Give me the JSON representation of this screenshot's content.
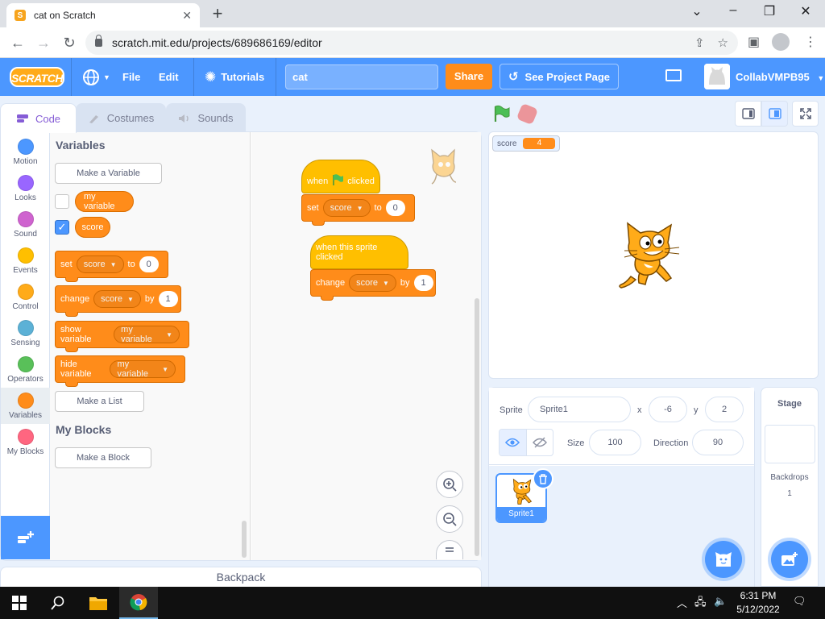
{
  "browser": {
    "tab_title": "cat on Scratch",
    "url": "scratch.mit.edu/projects/689686169/editor"
  },
  "menubar": {
    "logo_text": "SCRATCH",
    "file": "File",
    "edit": "Edit",
    "tutorials": "Tutorials",
    "project_title": "cat",
    "share": "Share",
    "see_project_page": "See Project Page",
    "username": "CollabVMPB95"
  },
  "editor_tabs": {
    "code": "Code",
    "costumes": "Costumes",
    "sounds": "Sounds"
  },
  "categories": [
    {
      "label": "Motion",
      "color": "#4c97ff"
    },
    {
      "label": "Looks",
      "color": "#9966ff"
    },
    {
      "label": "Sound",
      "color": "#cf63cf"
    },
    {
      "label": "Events",
      "color": "#ffbf00"
    },
    {
      "label": "Control",
      "color": "#ffab19"
    },
    {
      "label": "Sensing",
      "color": "#5cb1d6"
    },
    {
      "label": "Operators",
      "color": "#59c059"
    },
    {
      "label": "Variables",
      "color": "#ff8c1a"
    },
    {
      "label": "My Blocks",
      "color": "#ff6680"
    }
  ],
  "palette": {
    "variables_heading": "Variables",
    "make_variable": "Make a Variable",
    "var_my_variable": "my variable",
    "var_score": "score",
    "block_set": {
      "verb": "set",
      "var": "score",
      "to": "to",
      "value": "0"
    },
    "block_change": {
      "verb": "change",
      "var": "score",
      "by": "by",
      "value": "1"
    },
    "block_show": {
      "verb": "show variable",
      "var": "my variable"
    },
    "block_hide": {
      "verb": "hide variable",
      "var": "my variable"
    },
    "make_list": "Make a List",
    "myblocks_heading": "My Blocks",
    "make_block": "Make a Block"
  },
  "scripts": {
    "script1": {
      "hat_when": "when",
      "hat_clicked": "clicked",
      "set_verb": "set",
      "set_var": "score",
      "set_to": "to",
      "set_value": "0"
    },
    "script2": {
      "hat": "when this sprite clicked",
      "change_verb": "change",
      "change_var": "score",
      "change_by": "by",
      "change_value": "1"
    }
  },
  "backpack": "Backpack",
  "stage": {
    "monitor_label": "score",
    "monitor_value": "4"
  },
  "sprite_info": {
    "sprite_label": "Sprite",
    "sprite_name": "Sprite1",
    "x_label": "x",
    "x_value": "-6",
    "y_label": "y",
    "y_value": "2",
    "size_label": "Size",
    "size_value": "100",
    "direction_label": "Direction",
    "direction_value": "90"
  },
  "sprite_list": [
    {
      "name": "Sprite1"
    }
  ],
  "stage_pane": {
    "title": "Stage",
    "backdrops_label": "Backdrops",
    "backdrops_count": "1"
  },
  "taskbar": {
    "time": "6:31 PM",
    "date": "5/12/2022"
  }
}
